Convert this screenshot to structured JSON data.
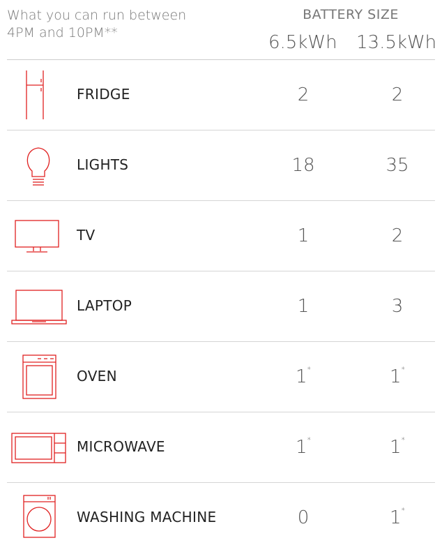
{
  "header": {
    "intro_line1": "What you can run between",
    "intro_line2": "4PM and 10PM**",
    "battery_title": "BATTERY SIZE",
    "size_small": "6.5kWh",
    "size_large": "13.5kWh"
  },
  "accent_color": "#e02020",
  "appliances": [
    {
      "icon": "fridge-icon",
      "label": "FRIDGE",
      "small": "2",
      "small_sup": "",
      "large": "2",
      "large_sup": ""
    },
    {
      "icon": "lightbulb-icon",
      "label": "LIGHTS",
      "small": "18",
      "small_sup": "",
      "large": "35",
      "large_sup": ""
    },
    {
      "icon": "tv-icon",
      "label": "TV",
      "small": "1",
      "small_sup": "",
      "large": "2",
      "large_sup": ""
    },
    {
      "icon": "laptop-icon",
      "label": "LAPTOP",
      "small": "1",
      "small_sup": "",
      "large": "3",
      "large_sup": ""
    },
    {
      "icon": "oven-icon",
      "label": "OVEN",
      "small": "1",
      "small_sup": "*",
      "large": "1",
      "large_sup": "*"
    },
    {
      "icon": "microwave-icon",
      "label": "MICROWAVE",
      "small": "1",
      "small_sup": "*",
      "large": "1",
      "large_sup": "*"
    },
    {
      "icon": "washing-machine-icon",
      "label": "WASHING MACHINE",
      "small": "0",
      "small_sup": "",
      "large": "1",
      "large_sup": "*"
    }
  ]
}
